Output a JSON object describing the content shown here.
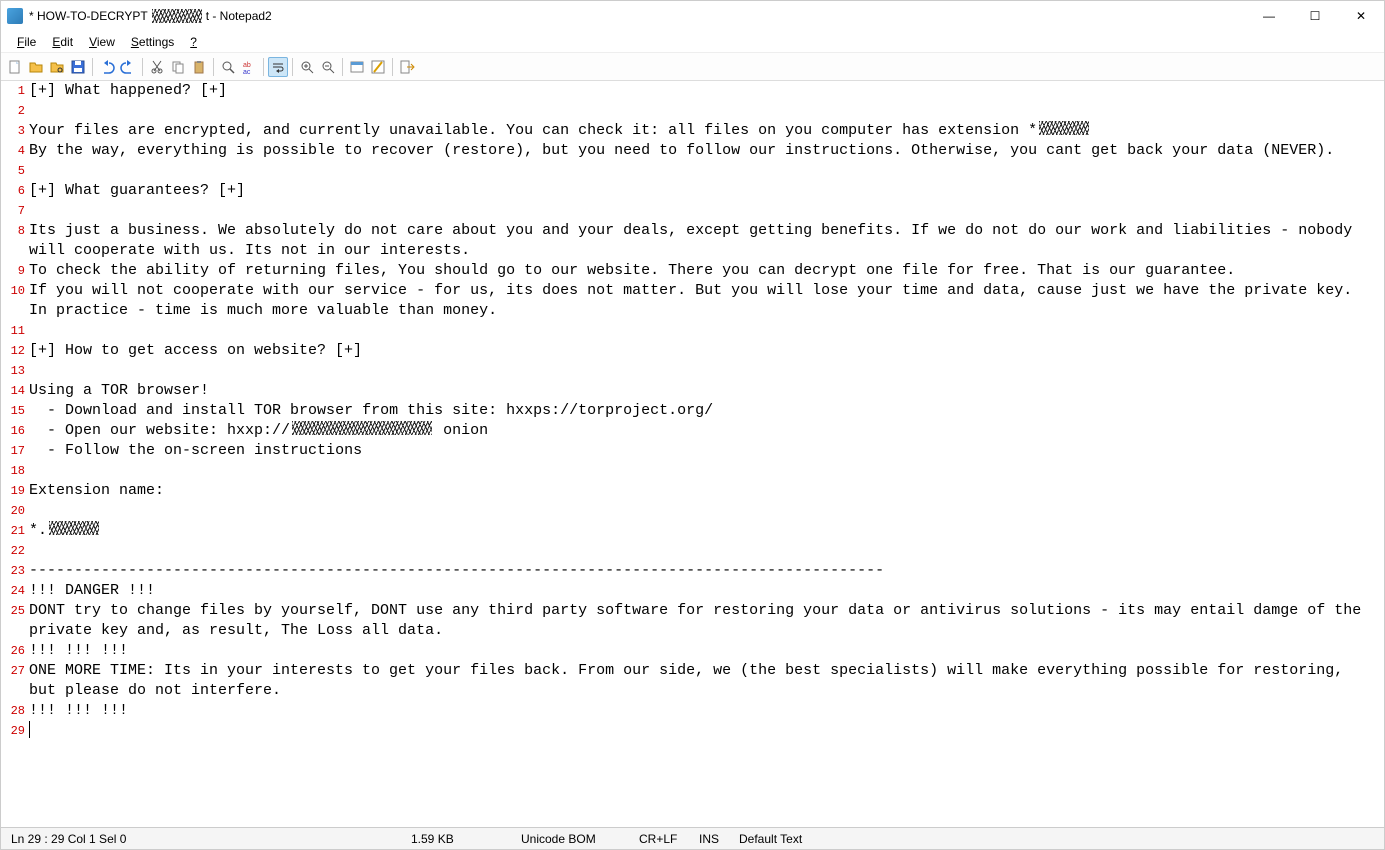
{
  "title": {
    "prefix": "* HOW-TO-DECRYPT",
    "suffix": "t - Notepad2"
  },
  "window_controls": {
    "min": "—",
    "max": "☐",
    "close": "✕"
  },
  "menu": {
    "file": "File",
    "edit": "Edit",
    "view": "View",
    "settings": "Settings",
    "help": "?"
  },
  "toolbar_icons": [
    "new",
    "open",
    "browse",
    "save",
    "undo",
    "redo",
    "cut",
    "copy",
    "paste",
    "find",
    "replace",
    "wordwrap",
    "zoom-in",
    "zoom-out",
    "scheme",
    "options",
    "exit"
  ],
  "lines": [
    {
      "n": 1,
      "t": "[+] What happened? [+]"
    },
    {
      "n": 2,
      "t": ""
    },
    {
      "n": 3,
      "t": "Your files are encrypted, and currently unavailable. You can check it: all files on you computer has extension *",
      "scribble_after": "sm"
    },
    {
      "n": 4,
      "t": "By the way, everything is possible to recover (restore), but you need to follow our instructions. Otherwise, you cant get back your data (NEVER)."
    },
    {
      "n": 5,
      "t": ""
    },
    {
      "n": 6,
      "t": "[+] What guarantees? [+]"
    },
    {
      "n": 7,
      "t": ""
    },
    {
      "n": 8,
      "t": "Its just a business. We absolutely do not care about you and your deals, except getting benefits. If we do not do our work and liabilities - nobody will cooperate with us. Its not in our interests."
    },
    {
      "n": 9,
      "t": "To check the ability of returning files, You should go to our website. There you can decrypt one file for free. That is our guarantee."
    },
    {
      "n": 10,
      "t": "If you will not cooperate with our service - for us, its does not matter. But you will lose your time and data, cause just we have the private key. In practice - time is much more valuable than money."
    },
    {
      "n": 11,
      "t": ""
    },
    {
      "n": 12,
      "t": "[+] How to get access on website? [+]"
    },
    {
      "n": 13,
      "t": ""
    },
    {
      "n": 14,
      "t": "Using a TOR browser!"
    },
    {
      "n": 15,
      "t": "  - Download and install TOR browser from this site: hxxps://torproject.org/"
    },
    {
      "n": 16,
      "t": "  - Open our website: hxxp://",
      "scribble_after": "lg",
      "post": " onion"
    },
    {
      "n": 17,
      "t": "  - Follow the on-screen instructions"
    },
    {
      "n": 18,
      "t": ""
    },
    {
      "n": 19,
      "t": "Extension name:"
    },
    {
      "n": 20,
      "t": ""
    },
    {
      "n": 21,
      "t": "*.",
      "scribble_after": "sm"
    },
    {
      "n": 22,
      "t": ""
    },
    {
      "n": 23,
      "t": "-----------------------------------------------------------------------------------------------"
    },
    {
      "n": 24,
      "t": "!!! DANGER !!!"
    },
    {
      "n": 25,
      "t": "DONT try to change files by yourself, DONT use any third party software for restoring your data or antivirus solutions - its may entail damge of the private key and, as result, The Loss all data."
    },
    {
      "n": 26,
      "t": "!!! !!! !!!"
    },
    {
      "n": 27,
      "t": "ONE MORE TIME: Its in your interests to get your files back. From our side, we (the best specialists) will make everything possible for restoring, but please do not interfere."
    },
    {
      "n": 28,
      "t": "!!! !!! !!!"
    },
    {
      "n": 29,
      "t": "",
      "cursor": true
    }
  ],
  "status": {
    "pos": "Ln 29 : 29   Col 1   Sel 0",
    "size": "1.59 KB",
    "enc": "Unicode BOM",
    "eol": "CR+LF",
    "mode": "INS",
    "scheme": "Default Text"
  }
}
